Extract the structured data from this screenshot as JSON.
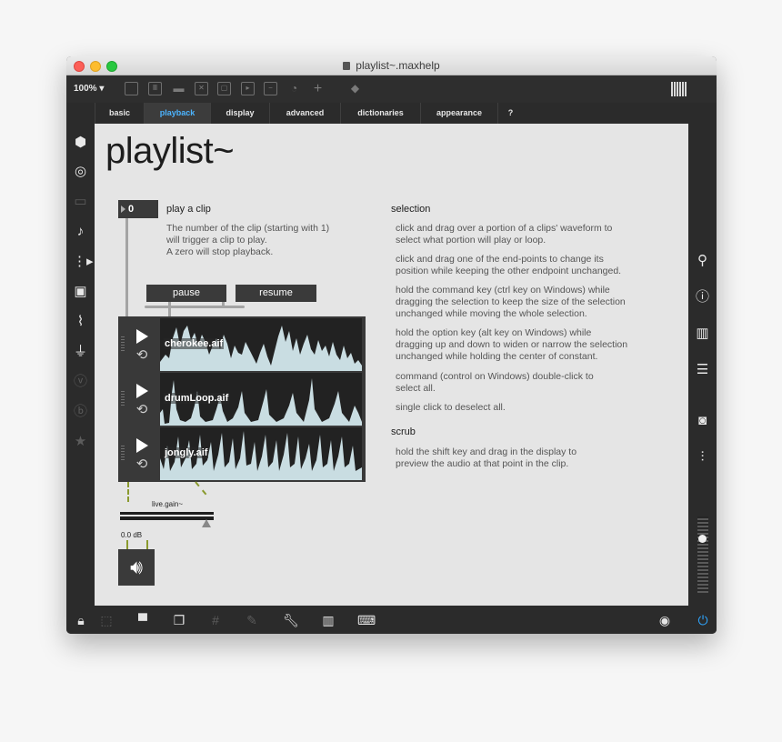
{
  "window": {
    "title": "playlist~.maxhelp"
  },
  "toolbar": {
    "zoom": "100%",
    "icons": [
      "presentation-icon",
      "comment-icon",
      "speech-icon",
      "close-box-icon",
      "target-icon",
      "inlet-icon",
      "minus-box-icon",
      "gauge-icon",
      "plus-icon",
      "paint-bucket-icon",
      "grid-icon"
    ]
  },
  "tabs": [
    {
      "label": "basic",
      "active": false
    },
    {
      "label": "playback",
      "active": true
    },
    {
      "label": "display",
      "active": false
    },
    {
      "label": "advanced",
      "active": false
    },
    {
      "label": "dictionaries",
      "active": false
    },
    {
      "label": "appearance",
      "active": false
    },
    {
      "label": "?",
      "active": false
    }
  ],
  "content": {
    "title": "playlist~",
    "number_box_value": "0",
    "play_clip": {
      "label": "play a clip",
      "desc1": "The number of the clip (starting with 1)",
      "desc2": "will trigger a clip to play.",
      "desc3": "A zero will stop playback."
    },
    "buttons": {
      "pause": "pause",
      "resume": "resume"
    },
    "clips": [
      {
        "name": "cherokee.aif"
      },
      {
        "name": "drumLoop.aif"
      },
      {
        "name": "jongly.aif"
      }
    ],
    "gain": {
      "label": "live.gain~",
      "db": "0.0 dB"
    },
    "selection": {
      "heading": "selection",
      "items": [
        [
          "click and drag over a portion of a clips' waveform to",
          "select what portion will play or loop."
        ],
        [
          "click and drag one of the end-points to change its",
          "position while keeping the other endpoint unchanged."
        ],
        [
          "hold the command key (ctrl key on Windows) while",
          "dragging the selection to keep the size of the selection",
          "unchanged while moving the whole selection."
        ],
        [
          "hold the option key (alt key on Windows) while",
          "dragging up and down to widen or narrow the selection",
          "unchanged while holding the center of constant."
        ],
        [
          "command (control on Windows) double-click to",
          "select all."
        ],
        [
          "single click to deselect all."
        ]
      ]
    },
    "scrub": {
      "heading": "scrub",
      "lines": [
        "hold the shift key and drag in the display to",
        "preview the audio at that point in the clip."
      ]
    }
  },
  "colors": {
    "accent": "#4cb4ff",
    "waveform": "#c9dde2",
    "panel": "#2b2b2b",
    "canvas": "#e5e5e5"
  }
}
